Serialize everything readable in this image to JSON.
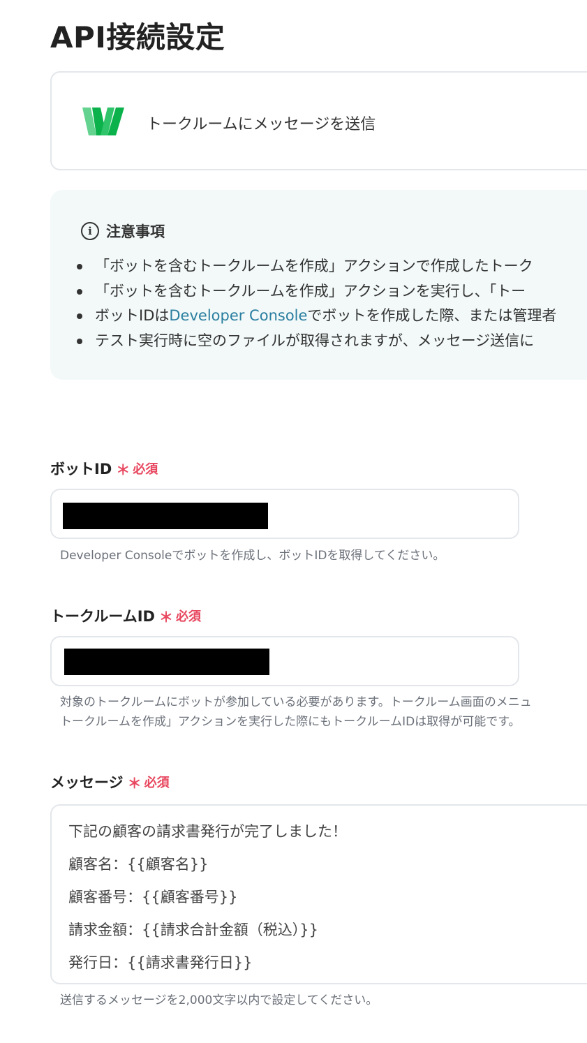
{
  "page": {
    "title": "API接続設定"
  },
  "action": {
    "name": "トークルームにメッセージを送信",
    "logo_letter": "W",
    "logo_colors": [
      "#0bb24c",
      "#5fd68a"
    ]
  },
  "notice": {
    "title": "注意事項",
    "info_icon": "info-icon",
    "items": [
      "「ボットを含むトークルームを作成」アクションで作成したトーク",
      "「ボットを含むトークルームを作成」アクションを実行し、「トー",
      {
        "before": "ボットIDは",
        "link": "Developer Console",
        "after": "でボットを作成した際、または管理者"
      },
      "テスト実行時に空のファイルが取得されますが、メッセージ送信に"
    ]
  },
  "fields": {
    "bot_id": {
      "label": "ボットID",
      "required_mark": "＊",
      "required_text": "必須",
      "value_redacted": true,
      "help": "Developer Consoleでボットを作成し、ボットIDを取得してください。"
    },
    "room_id": {
      "label": "トークルームID",
      "required_mark": "＊",
      "required_text": "必須",
      "value_redacted": true,
      "help_lines": [
        "対象のトークルームにボットが参加している必要があります。トークルーム画面のメニュ",
        "トークルームを作成」アクションを実行した際にもトークルームIDは取得が可能です。"
      ]
    },
    "message": {
      "label": "メッセージ",
      "required_mark": "＊",
      "required_text": "必須",
      "lines": [
        "下記の顧客の請求書発行が完了しました！",
        "顧客名：{{顧客名}}",
        "顧客番号：{{顧客番号}}",
        "請求金額：{{請求合計金額（税込）}}",
        "発行日：{{請求書発行日}}"
      ],
      "help": "送信するメッセージを2,000文字以内で設定してください。"
    }
  },
  "colors": {
    "required": "#e8475f",
    "link": "#2a7ea0",
    "notice_bg": "#f2f9f8",
    "border": "#e3e6ea"
  }
}
